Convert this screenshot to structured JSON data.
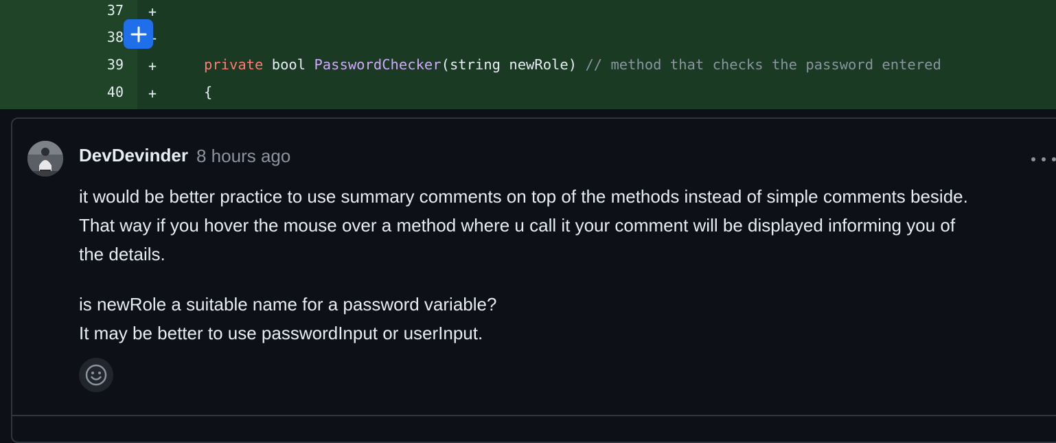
{
  "diff": {
    "rows": [
      {
        "num": "37",
        "marker": "+"
      },
      {
        "num": "38",
        "marker": "+"
      },
      {
        "num": "39",
        "marker": "+"
      },
      {
        "num": "40",
        "marker": "+"
      }
    ],
    "line39": {
      "kw": "private",
      "type": "bool",
      "fn": "PasswordChecker",
      "params": "(string newRole)",
      "comment": "// method that checks the password entered"
    },
    "line40": {
      "text": "{"
    }
  },
  "comment": {
    "author": "DevDevinder",
    "timestamp": "8 hours ago",
    "paragraphs": [
      "it would be better practice to use summary comments on top of the methods instead of simple comments beside.",
      "That way if you hover the mouse over a method where u call it your comment will be displayed informing you of",
      "the details.",
      "is newRole a suitable name for a password variable?",
      "It may be better to use passwordInput or userInput."
    ]
  },
  "icons": {
    "add_comment": "plus-icon",
    "menu": "kebab-horizontal-icon",
    "reaction": "smiley-icon",
    "avatar": "user-avatar"
  },
  "colors": {
    "diff_gutter": "#1f4428",
    "diff_code": "#1a3a24",
    "background": "#0d1117",
    "keyword": "#ff7b72",
    "function": "#d2a8ff",
    "comment": "#8b949e",
    "accent": "#1f6feb"
  }
}
